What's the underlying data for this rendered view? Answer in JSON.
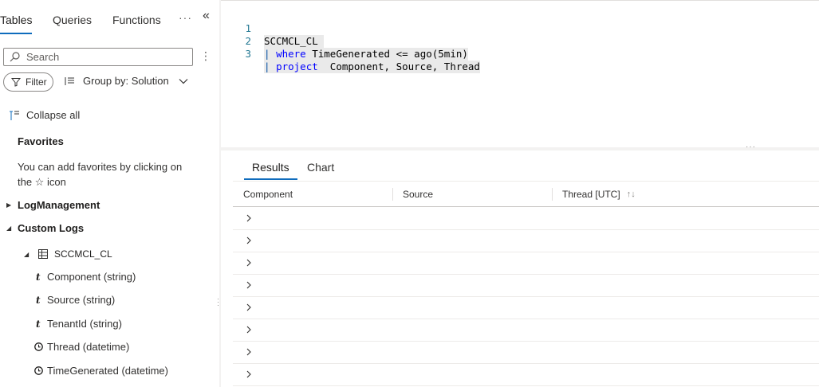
{
  "left": {
    "tabs": [
      {
        "label": "Tables",
        "active": true
      },
      {
        "label": "Queries",
        "active": false
      },
      {
        "label": "Functions",
        "active": false
      }
    ],
    "more_label": "···",
    "collapse_panel_label": "«",
    "search": {
      "placeholder": "Search",
      "value": ""
    },
    "kebab_label": "⋮",
    "filter_label": "Filter",
    "group_by_label": "Group by: Solution",
    "collapse_all_label": "Collapse all",
    "favorites": {
      "title": "Favorites",
      "hint_line1": "You can add favorites by clicking on",
      "hint_line2": "the ☆ icon"
    },
    "tree": {
      "log_management": "LogManagement",
      "custom_logs": "Custom Logs",
      "table": "SCCMCL_CL",
      "fields": [
        {
          "type_icon": "t",
          "label": "Component (string)"
        },
        {
          "type_icon": "t",
          "label": "Source (string)"
        },
        {
          "type_icon": "t",
          "label": "TenantId (string)"
        },
        {
          "type_icon": "clock",
          "label": "Thread (datetime)"
        },
        {
          "type_icon": "clock",
          "label": "TimeGenerated (datetime)"
        }
      ]
    }
  },
  "editor": {
    "lines": [
      {
        "num": "1",
        "text": "SCCMCL_CL "
      },
      {
        "num": "2",
        "pipe": "| ",
        "keyword": "where",
        "rest": " TimeGenerated <= ago(5min)"
      },
      {
        "num": "3",
        "pipe": "| ",
        "keyword": "project",
        "rest": "  Component, Source, Thread"
      }
    ]
  },
  "results": {
    "tabs": [
      {
        "label": "Results",
        "active": true
      },
      {
        "label": "Chart",
        "active": false
      }
    ],
    "columns": [
      "Component",
      "Source",
      "Thread [UTC]"
    ],
    "sort_icon": "↑↓",
    "row_count": 8
  },
  "colors": {
    "accent": "#0f6cbd",
    "keyword": "#0000ff",
    "line_number": "#237893"
  }
}
